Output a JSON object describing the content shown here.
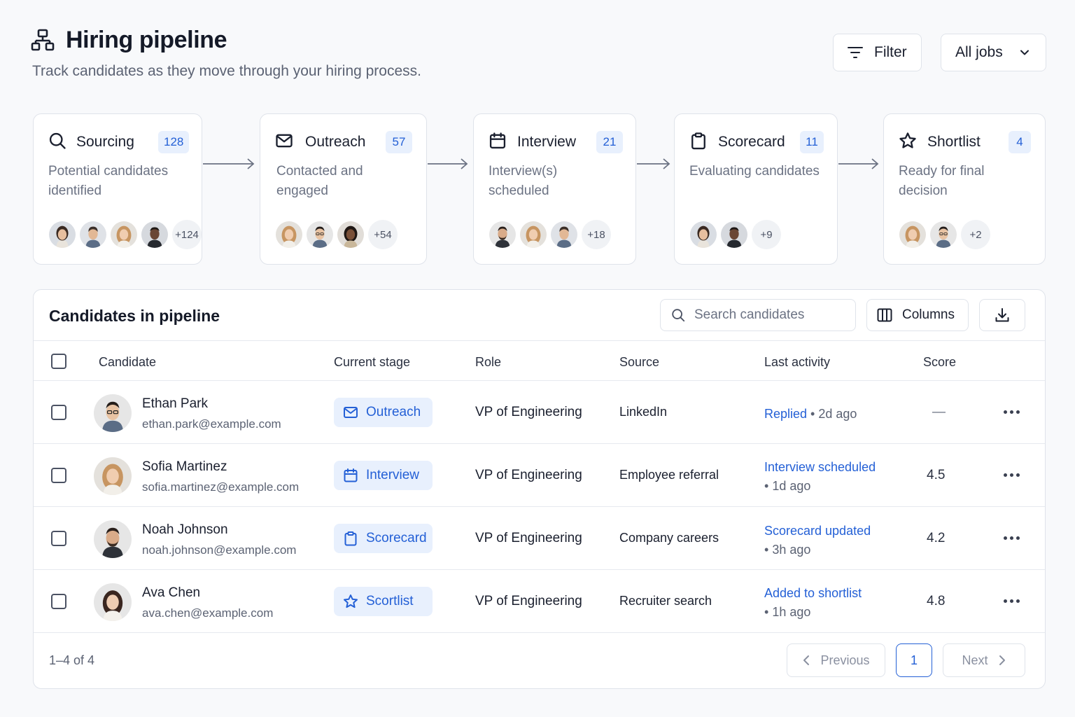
{
  "header": {
    "title": "Hiring pipeline",
    "subtitle": "Track candidates as they move through your hiring process.",
    "filter_label": "Filter",
    "jobs_select": "All jobs",
    "title_icon": "org-chart-icon"
  },
  "stages": [
    {
      "name": "Sourcing",
      "count": "128",
      "desc": "Potential candidates identified",
      "more": "+124",
      "icon": "search-icon"
    },
    {
      "name": "Outreach",
      "count": "57",
      "desc": "Contacted and engaged",
      "more": "+54",
      "icon": "mail-icon"
    },
    {
      "name": "Interview",
      "count": "21",
      "desc": "Interview(s) scheduled",
      "more": "+18",
      "icon": "calendar-icon"
    },
    {
      "name": "Scorecard",
      "count": "11",
      "desc": "Evaluating candidates",
      "more": "+9",
      "icon": "clipboard-icon"
    },
    {
      "name": "Shortlist",
      "count": "4",
      "desc": "Ready for final decision",
      "more": "+2",
      "icon": "star-icon"
    }
  ],
  "table": {
    "title": "Candidates in pipeline",
    "search_placeholder": "Search candidates",
    "columns_label": "Columns",
    "headers": {
      "candidate": "Candidate",
      "stage": "Current stage",
      "role": "Role",
      "source": "Source",
      "activity": "Last activity",
      "score": "Score"
    },
    "rows": [
      {
        "name": "Ethan Park",
        "email": "ethan.park@example.com",
        "stage": "Outreach",
        "role": "VP of Engineering",
        "source": "LinkedIn",
        "activity": "Replied",
        "ago": "2d ago",
        "score": "—"
      },
      {
        "name": "Sofia Martinez",
        "email": "sofia.martinez@example.com",
        "stage": "Interview",
        "role": "VP of Engineering",
        "source": "Employee referral",
        "activity": "Interview scheduled",
        "ago": "1d ago",
        "score": "4.5"
      },
      {
        "name": "Noah Johnson",
        "email": "noah.johnson@example.com",
        "stage": "Scorecard",
        "role": "VP of Engineering",
        "source": "Company careers",
        "activity": "Scorecard updated",
        "ago": "3h ago",
        "score": "4.2"
      },
      {
        "name": "Ava Chen",
        "email": "ava.chen@example.com",
        "stage": "Scortlist",
        "role": "VP of Engineering",
        "source": "Recruiter search",
        "activity": "Added to shortlist",
        "ago": "1h ago",
        "score": "4.8"
      }
    ]
  },
  "pagination": {
    "range": "1–4 of 4",
    "previous": "Previous",
    "page": "1",
    "next": "Next"
  },
  "colors": {
    "accent": "#2460d6",
    "accent_bg": "#e8f0fd",
    "border": "#dfe3ea"
  }
}
